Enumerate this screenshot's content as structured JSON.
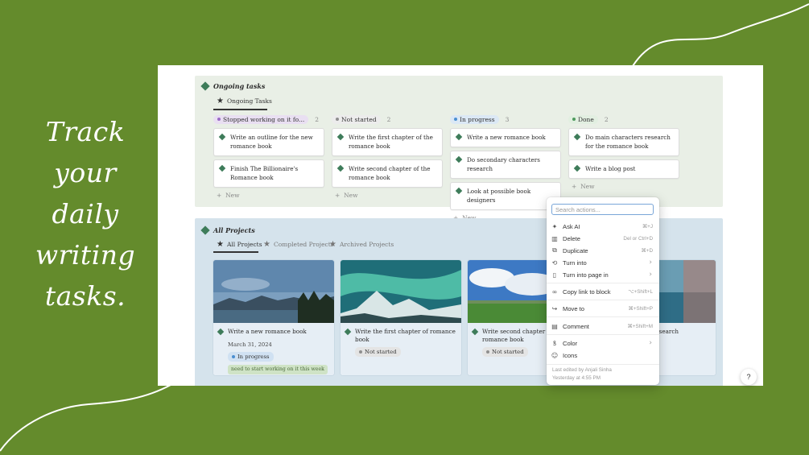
{
  "promo": {
    "lines": [
      "Track",
      "your",
      "daily",
      "writing",
      "tasks."
    ]
  },
  "ongoing": {
    "title": "Ongoing tasks",
    "view_tab": "Ongoing Tasks",
    "new_label": "New",
    "columns": [
      {
        "status": "Stopped working on it fo...",
        "count": "2",
        "color": "#e9dff2",
        "dot": "#9b6cc6",
        "cards": [
          "Write an outline for the new romance book",
          "Finish The Billionaire's Romance book"
        ]
      },
      {
        "status": "Not started",
        "count": "2",
        "color": "#ececec",
        "dot": "#8f8f8f",
        "cards": [
          "Write the first chapter of the romance book",
          "Write second chapter of the romance book"
        ]
      },
      {
        "status": "In progress",
        "count": "3",
        "color": "#dbe8f5",
        "dot": "#4b8fd1",
        "cards": [
          "Write a new romance book",
          "Do secondary characters research",
          "Look at possible book designers"
        ]
      },
      {
        "status": "Done",
        "count": "2",
        "color": "#e2efe1",
        "dot": "#4f9a5e",
        "cards": [
          "Do main characters research for the romance book",
          "Write a blog post"
        ]
      }
    ]
  },
  "projects": {
    "title": "All Projects",
    "tabs": [
      "All Projects",
      "Completed Projects",
      "Archived Projects"
    ],
    "cards": [
      {
        "title": "Write a new romance book",
        "date": "March 31, 2024",
        "status": "In progress",
        "status_bg": "#d0e1f2",
        "status_dot": "#4b8fd1",
        "tag": "need to start working on it this week"
      },
      {
        "title": "Write the first chapter of romance book",
        "status": "Not started",
        "status_bg": "#e4e4e4",
        "status_dot": "#8f8f8f"
      },
      {
        "title": "Write second chapter of the romance book",
        "status": "Not started",
        "status_bg": "#e4e4e4",
        "status_dot": "#8f8f8f"
      },
      {
        "title": "cters research"
      }
    ]
  },
  "menu": {
    "search_placeholder": "Search actions...",
    "items": [
      {
        "label": "Ask AI",
        "shortcut": "⌘+J",
        "icon": "sparkle-icon",
        "glyph": "✦"
      },
      {
        "label": "Delete",
        "shortcut": "Del or Ctrl+D",
        "icon": "trash-icon",
        "glyph": "🗑"
      },
      {
        "label": "Duplicate",
        "shortcut": "⌘+D",
        "icon": "duplicate-icon",
        "glyph": "⧉"
      },
      {
        "label": "Turn into",
        "shortcut": "",
        "icon": "turn-into-icon",
        "glyph": "⟲",
        "submenu": true
      },
      {
        "label": "Turn into page in",
        "shortcut": "",
        "icon": "page-icon",
        "glyph": "▯",
        "submenu": true
      },
      {
        "label": "Copy link to block",
        "shortcut": "⌥+Shift+L",
        "icon": "link-icon",
        "glyph": "🔗"
      },
      {
        "label": "Move to",
        "shortcut": "⌘+Shift+P",
        "icon": "move-icon",
        "glyph": "↪"
      },
      {
        "label": "Comment",
        "shortcut": "⌘+Shift+M",
        "icon": "comment-icon",
        "glyph": "▤"
      },
      {
        "label": "Color",
        "shortcut": "",
        "icon": "color-icon",
        "glyph": "ᚁ",
        "submenu": true
      },
      {
        "label": "Icons",
        "shortcut": "",
        "icon": "smiley-icon",
        "glyph": "☺"
      }
    ],
    "footer_line1": "Last edited by Anjali Sinha",
    "footer_line2": "Yesterday at 4:55 PM"
  },
  "help_label": "?",
  "colors": {
    "background": "#648b2c",
    "accent_diamond": "#3e7c5a",
    "ongoing_bg": "#e9efe6",
    "projects_bg": "#d5e3ec"
  }
}
